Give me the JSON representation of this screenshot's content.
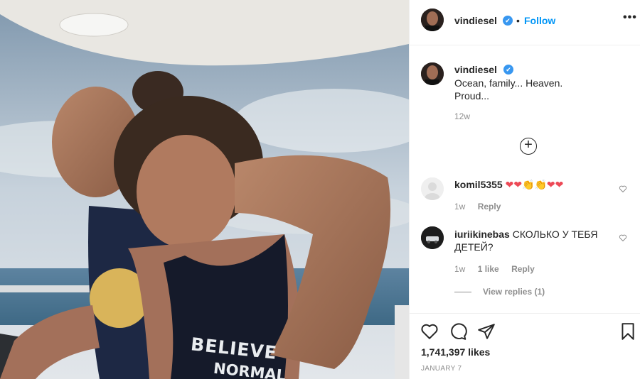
{
  "post": {
    "author": "vindiesel",
    "follow_label": "Follow",
    "separator": "•",
    "more_label": "•••",
    "caption": "Ocean, family... Heaven.\nProud...",
    "caption_time": "12w",
    "shirt_line1": "BELIEVE",
    "shirt_line2": "NORMAL",
    "likes": "1,741,397 likes",
    "date": "JANUARY 7"
  },
  "comments": [
    {
      "user": "komil5355",
      "text": "❤❤👏👏❤❤",
      "time": "1w",
      "reply_label": "Reply"
    },
    {
      "user": "iuriikinebas",
      "text": "СКОЛЬКО У ТЕБЯ ДЕТЕЙ?",
      "time": "1w",
      "likes": "1 like",
      "reply_label": "Reply",
      "view_replies": "View replies (1)"
    }
  ],
  "icons": {
    "verified": "✔",
    "load_more": "+"
  },
  "colors": {
    "accent": "#0095f6",
    "verified": "#3897f0"
  }
}
